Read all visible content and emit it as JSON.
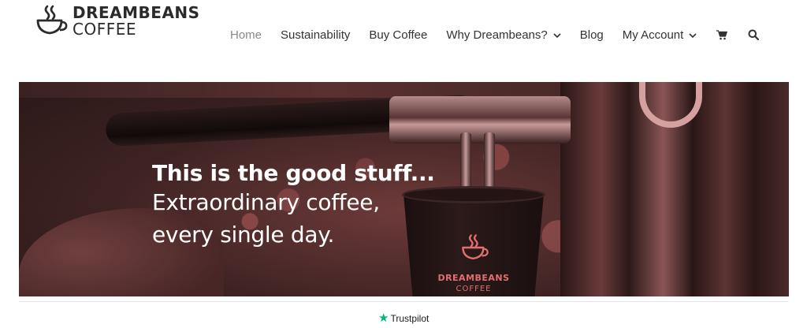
{
  "brand": {
    "line1": "DREAMBEANS",
    "line2": "COFFEE"
  },
  "nav": {
    "items": [
      {
        "label": "Home",
        "active": true,
        "has_dropdown": false
      },
      {
        "label": "Sustainability",
        "active": false,
        "has_dropdown": false
      },
      {
        "label": "Buy Coffee",
        "active": false,
        "has_dropdown": false
      },
      {
        "label": "Why Dreambeans?",
        "active": false,
        "has_dropdown": true
      },
      {
        "label": "Blog",
        "active": false,
        "has_dropdown": false
      },
      {
        "label": "My Account",
        "active": false,
        "has_dropdown": true
      }
    ],
    "cart_icon": "cart-icon",
    "search_icon": "search-icon"
  },
  "hero": {
    "headline": "This is the good stuff...",
    "sub_line1": "Extraordinary coffee,",
    "sub_line2": "every single day.",
    "cup_brand_line1": "DREAMBEANS",
    "cup_brand_line2": "COFFEE"
  },
  "footer": {
    "trustpilot_label": "Trustpilot"
  },
  "colors": {
    "nav_active": "#8a8a8a",
    "trustpilot_green": "#00b67a",
    "cup_accent": "#e07070"
  }
}
